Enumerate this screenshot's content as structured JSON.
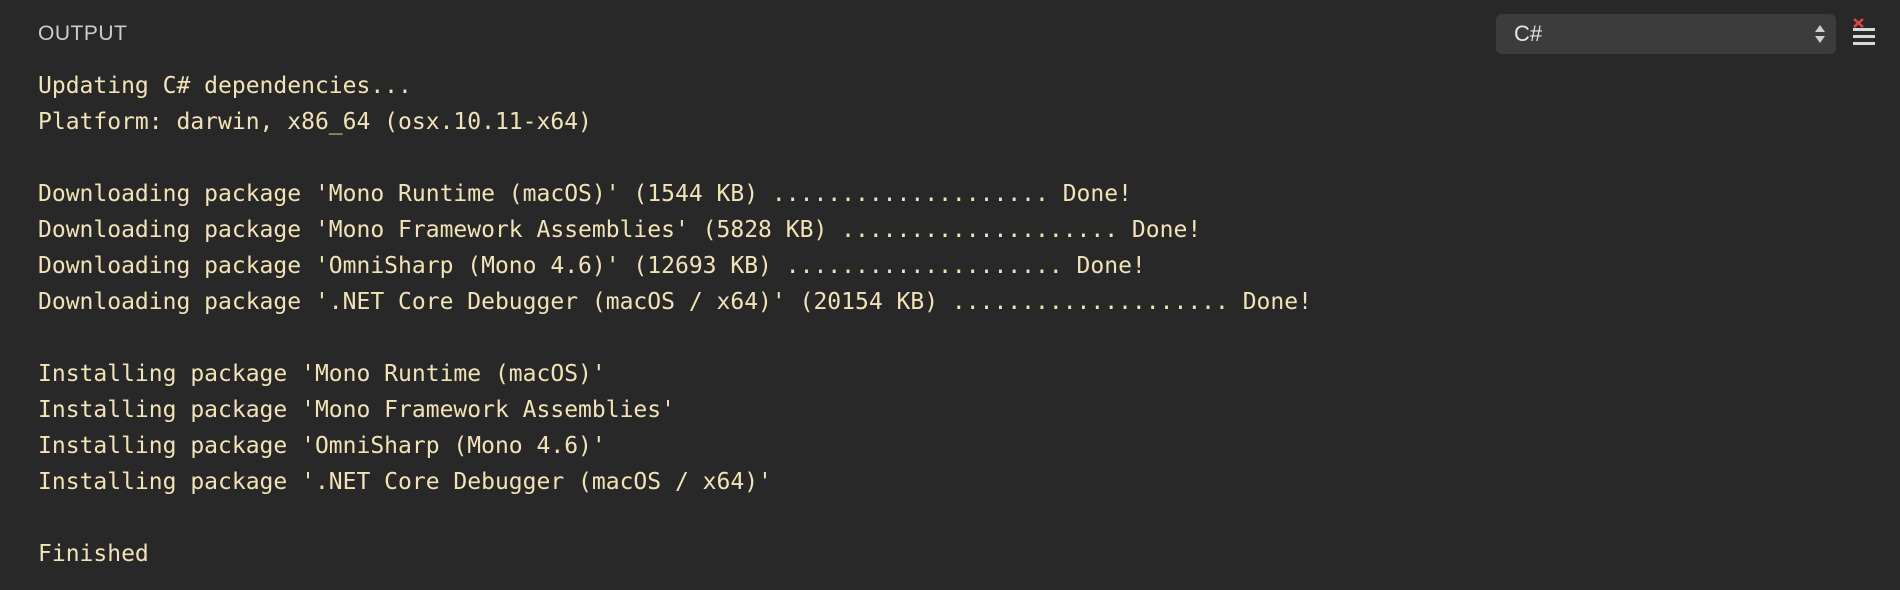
{
  "header": {
    "title": "OUTPUT",
    "channel_select": {
      "value": "C#",
      "icon": "up-down-arrows-icon"
    },
    "clear_button_icon": "clear-output-icon"
  },
  "colors": {
    "background": "#282828",
    "output_text": "#f1e3b6",
    "select_background": "#3c3c3c",
    "clear_icon_accent": "#e0483e"
  },
  "output": {
    "lines": [
      "Updating C# dependencies...",
      "Platform: darwin, x86_64 (osx.10.11-x64)",
      "",
      "Downloading package 'Mono Runtime (macOS)' (1544 KB) .................... Done!",
      "Downloading package 'Mono Framework Assemblies' (5828 KB) .................... Done!",
      "Downloading package 'OmniSharp (Mono 4.6)' (12693 KB) .................... Done!",
      "Downloading package '.NET Core Debugger (macOS / x64)' (20154 KB) .................... Done!",
      "",
      "Installing package 'Mono Runtime (macOS)'",
      "Installing package 'Mono Framework Assemblies'",
      "Installing package 'OmniSharp (Mono 4.6)'",
      "Installing package '.NET Core Debugger (macOS / x64)'",
      "",
      "Finished"
    ]
  }
}
